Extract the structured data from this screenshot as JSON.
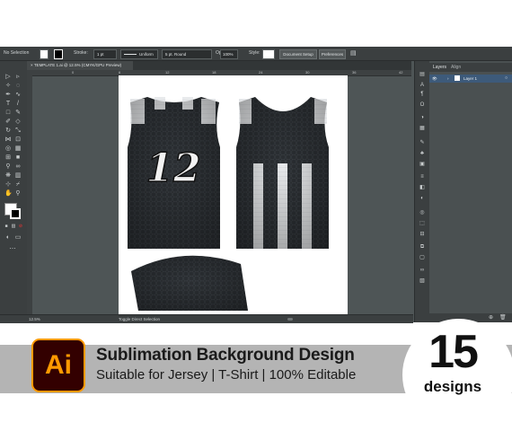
{
  "control_bar": {
    "selection": "No Selection",
    "stroke_label": "Stroke:",
    "stroke_value": "1 pt",
    "profile": "Uniform",
    "brush": "5 pt. Round",
    "opacity_label": "Opacity:",
    "opacity_value": "100%",
    "style_label": "Style:",
    "document_setup": "Document Setup",
    "preferences": "Preferences"
  },
  "document_tab": {
    "close": "×",
    "title": "TEMPLATE 1.ai @ 12.5% (CMYK/GPU Preview)"
  },
  "ruler_ticks": [
    "0",
    "6",
    "12",
    "18",
    "24",
    "30",
    "36",
    "42"
  ],
  "jersey": {
    "number": "12"
  },
  "layers_panel": {
    "tabs": [
      "Layers",
      "Align"
    ],
    "layer_name": "Layer 1"
  },
  "status_bar": {
    "zoom": "12.5%",
    "tool_hint": "Toggle Direct Selection"
  },
  "banner": {
    "logo_text": "Ai",
    "title": "Sublimation Background Design",
    "subtitle": "Suitable for Jersey | T-Shirt | 100% Editable",
    "count": "15",
    "count_label": "designs"
  },
  "colors": {
    "app_background": "#4e5556",
    "panel_dark": "#3b3f40",
    "jersey_dark": "#2b2f33",
    "stripe": "#e8eaec",
    "ai_orange": "#ff9a00",
    "ai_bg": "#330000",
    "banner_bar": "#b4b4b4"
  },
  "icons": {
    "visibility": "eye-icon",
    "lock": "lock-icon"
  }
}
